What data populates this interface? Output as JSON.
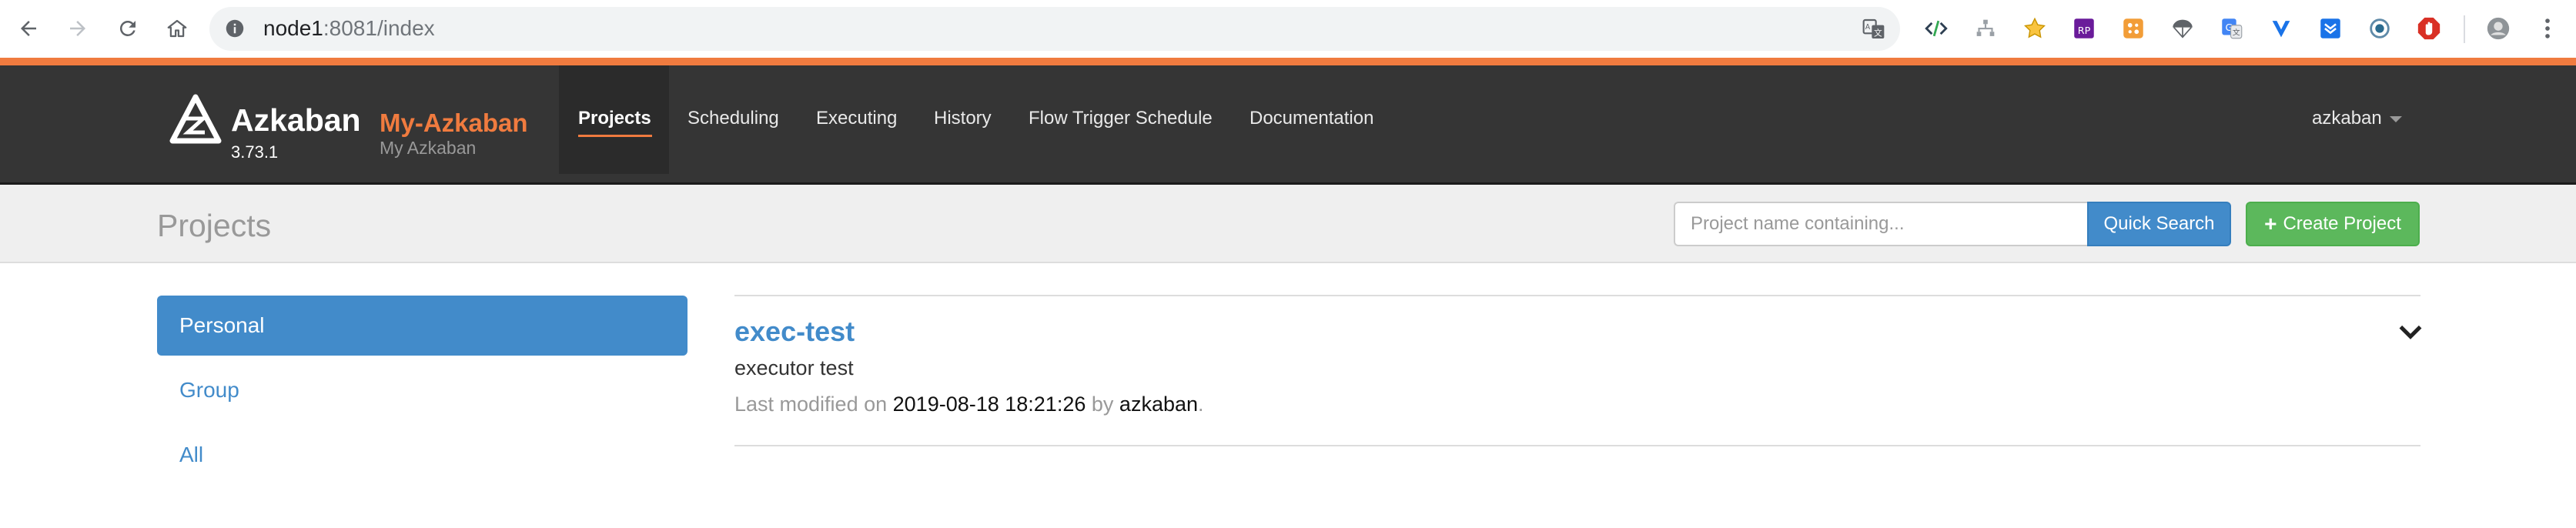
{
  "browser": {
    "url_host": "node1",
    "url_rest": ":8081/index"
  },
  "navbar": {
    "brand_name": "Azkaban",
    "version": "3.73.1",
    "env_name": "My-Azkaban",
    "env_desc": "My Azkaban",
    "links": [
      {
        "label": "Projects",
        "active": true
      },
      {
        "label": "Scheduling",
        "active": false
      },
      {
        "label": "Executing",
        "active": false
      },
      {
        "label": "History",
        "active": false
      },
      {
        "label": "Flow Trigger Schedule",
        "active": false
      },
      {
        "label": "Documentation",
        "active": false
      }
    ],
    "user": "azkaban"
  },
  "header": {
    "title": "Projects",
    "search_placeholder": "Project name containing...",
    "quick_search_label": "Quick Search",
    "create_project_label": "Create Project"
  },
  "sidebar": {
    "items": [
      {
        "label": "Personal",
        "active": true
      },
      {
        "label": "Group",
        "active": false
      },
      {
        "label": "All",
        "active": false
      }
    ]
  },
  "projects": [
    {
      "name": "exec-test",
      "description": "executor test",
      "modified_prefix": "Last modified on",
      "modified_time": "2019-08-18 18:21:26",
      "by_text": "by",
      "modified_by": "azkaban",
      "suffix": "."
    }
  ],
  "colors": {
    "brand_orange": "#f07b3f",
    "navbar_bg": "#353535",
    "primary_blue": "#428bca",
    "success_green": "#5cb85c"
  }
}
